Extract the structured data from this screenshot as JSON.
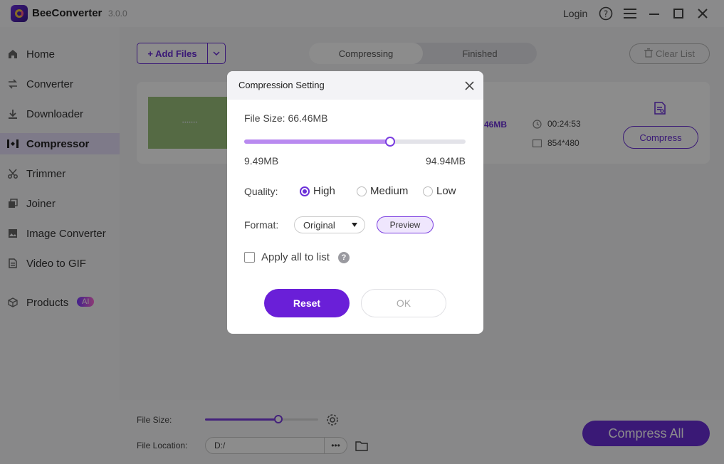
{
  "app": {
    "name": "BeeConverter",
    "version": "3.0.0",
    "login_label": "Login"
  },
  "sidebar": {
    "items": [
      {
        "label": "Home",
        "icon": "home-icon"
      },
      {
        "label": "Converter",
        "icon": "converter-icon"
      },
      {
        "label": "Downloader",
        "icon": "download-icon"
      },
      {
        "label": "Compressor",
        "icon": "compressor-icon",
        "active": true
      },
      {
        "label": "Trimmer",
        "icon": "scissors-icon"
      },
      {
        "label": "Joiner",
        "icon": "joiner-icon"
      },
      {
        "label": "Image Converter",
        "icon": "image-icon"
      },
      {
        "label": "Video to GIF",
        "icon": "gif-icon"
      },
      {
        "label": "Products",
        "icon": "cube-icon",
        "badge": "AI"
      }
    ]
  },
  "toolbar": {
    "add_files_label": "+ Add Files",
    "tabs": [
      {
        "label": "Compressing",
        "active": true
      },
      {
        "label": "Finished",
        "active": false
      }
    ],
    "clear_list_label": "Clear List"
  },
  "file_item": {
    "thumbnail_text": "•••••••",
    "size_fragment": "46MB",
    "duration": "00:24:53",
    "resolution": "854*480",
    "compress_label": "Compress"
  },
  "bottom": {
    "file_size_label": "File Size:",
    "file_size_fraction": 0.65,
    "file_location_label": "File Location:",
    "file_location_value": "D:/",
    "more_label": "•••",
    "compress_all_label": "Compress All"
  },
  "dialog": {
    "title": "Compression Setting",
    "file_size_label": "File Size: 66.46MB",
    "slider_fraction": 0.66,
    "range_min": "9.49MB",
    "range_max": "94.94MB",
    "quality_label": "Quality:",
    "quality_options": [
      {
        "label": "High",
        "checked": true
      },
      {
        "label": "Medium",
        "checked": false
      },
      {
        "label": "Low",
        "checked": false
      }
    ],
    "format_label": "Format:",
    "format_value": "Original",
    "preview_label": "Preview",
    "apply_all_label": "Apply all to list",
    "help_glyph": "?",
    "reset_label": "Reset",
    "ok_label": "OK"
  },
  "colors": {
    "accent": "#6a2ed8",
    "slider_fill": "#b98af0",
    "sidebar_active_bg": "#e6defa",
    "overlay": "rgba(0,0,0,0.45)"
  }
}
